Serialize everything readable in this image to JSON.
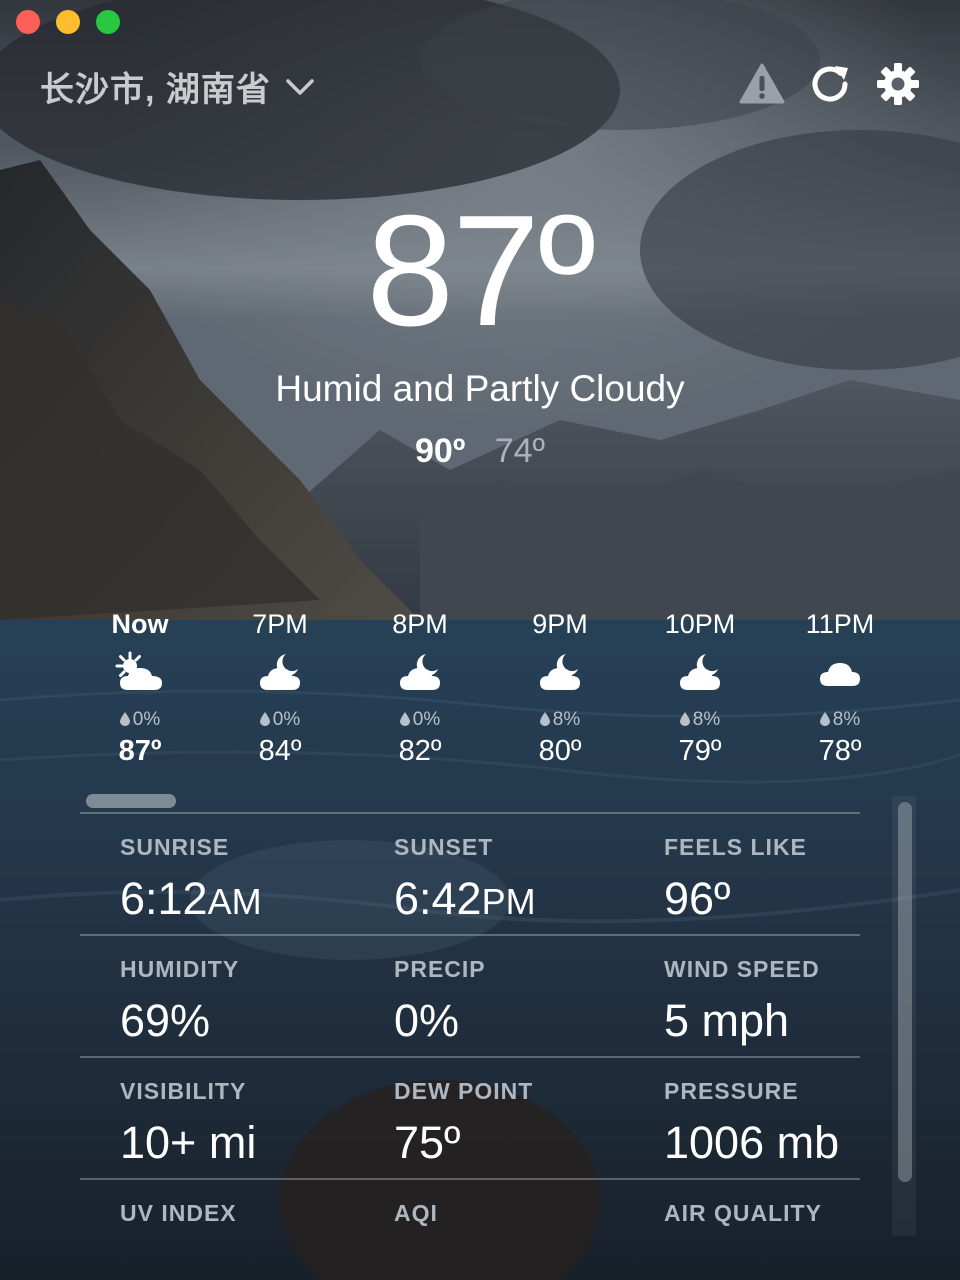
{
  "window": {
    "location": "长沙市, 湖南省"
  },
  "toolbar": {
    "icons": [
      "alert-icon",
      "refresh-icon",
      "gear-icon"
    ]
  },
  "current": {
    "temperature": "87º",
    "condition": "Humid and Partly Cloudy",
    "high": "90º",
    "low": "74º"
  },
  "hourly": [
    {
      "time": "Now",
      "icon": "partly-cloudy-day-icon",
      "precip": "0%",
      "temp": "87º"
    },
    {
      "time": "7PM",
      "icon": "partly-cloudy-night-icon",
      "precip": "0%",
      "temp": "84º"
    },
    {
      "time": "8PM",
      "icon": "partly-cloudy-night-icon",
      "precip": "0%",
      "temp": "82º"
    },
    {
      "time": "9PM",
      "icon": "partly-cloudy-night-icon",
      "precip": "8%",
      "temp": "80º"
    },
    {
      "time": "10PM",
      "icon": "partly-cloudy-night-icon",
      "precip": "8%",
      "temp": "79º"
    },
    {
      "time": "11PM",
      "icon": "cloud-icon",
      "precip": "8%",
      "temp": "78º"
    }
  ],
  "details": {
    "sunrise": {
      "label": "SUNRISE",
      "value": "6:12",
      "unit": "AM"
    },
    "sunset": {
      "label": "SUNSET",
      "value": "6:42",
      "unit": "PM"
    },
    "feels_like": {
      "label": "FEELS LIKE",
      "value": "96º"
    },
    "humidity": {
      "label": "HUMIDITY",
      "value": "69%"
    },
    "precip": {
      "label": "PRECIP",
      "value": "0%"
    },
    "wind_speed": {
      "label": "WIND SPEED",
      "value": "5 mph"
    },
    "visibility": {
      "label": "VISIBILITY",
      "value": "10+ mi"
    },
    "dew_point": {
      "label": "DEW POINT",
      "value": "75º"
    },
    "pressure": {
      "label": "PRESSURE",
      "value": "1006 mb"
    },
    "uv_index": {
      "label": "UV INDEX"
    },
    "aqi": {
      "label": "AQI"
    },
    "air_quality": {
      "label": "AIR QUALITY"
    }
  },
  "colors": {
    "close": "#fe5f57",
    "minimize": "#febc2e",
    "zoom": "#28c840"
  }
}
